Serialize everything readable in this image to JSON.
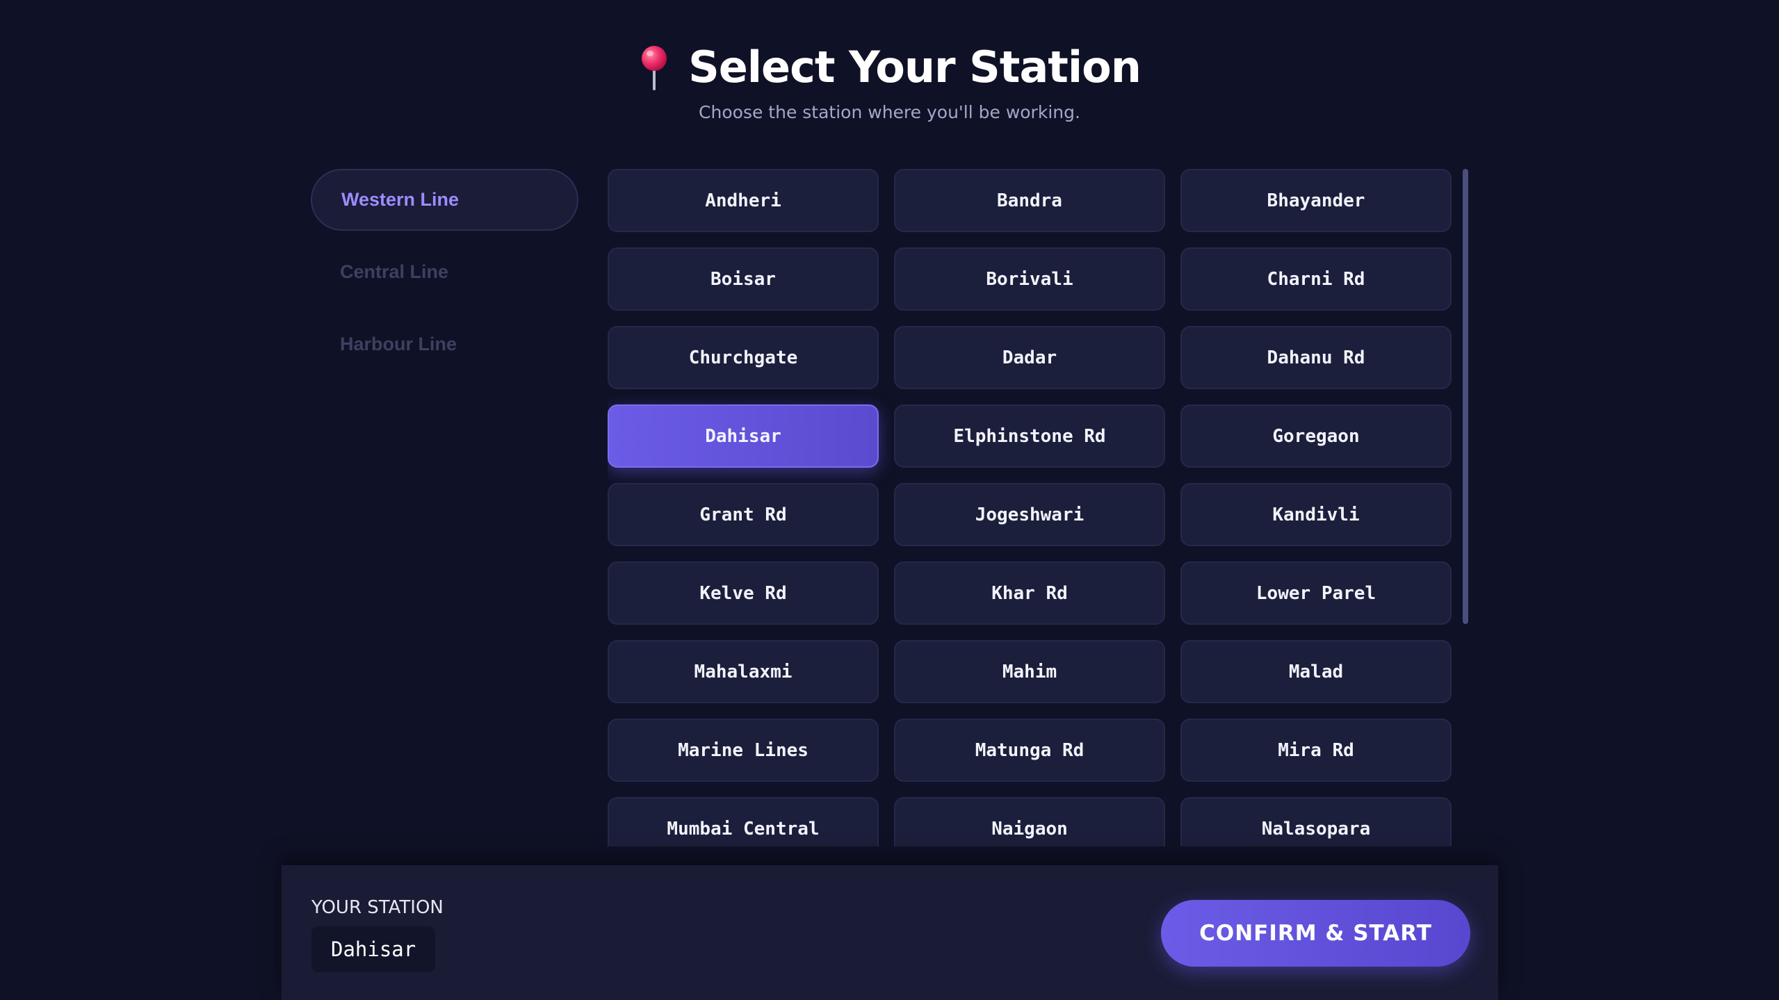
{
  "header": {
    "icon": "pushpin-icon",
    "title": "Select Your Station",
    "subtitle": "Choose the station where you'll be working."
  },
  "lines": [
    {
      "label": "Western Line",
      "active": true
    },
    {
      "label": "Central Line",
      "active": false
    },
    {
      "label": "Harbour Line",
      "active": false
    }
  ],
  "stations": [
    "Andheri",
    "Bandra",
    "Bhayander",
    "Boisar",
    "Borivali",
    "Charni Rd",
    "Churchgate",
    "Dadar",
    "Dahanu Rd",
    "Dahisar",
    "Elphinstone Rd",
    "Goregaon",
    "Grant Rd",
    "Jogeshwari",
    "Kandivli",
    "Kelve Rd",
    "Khar Rd",
    "Lower Parel",
    "Mahalaxmi",
    "Mahim",
    "Malad",
    "Marine Lines",
    "Matunga Rd",
    "Mira Rd",
    "Mumbai Central",
    "Naigaon",
    "Nalasopara"
  ],
  "selected_station": "Dahisar",
  "footer": {
    "label": "YOUR STATION",
    "value": "Dahisar",
    "confirm_label": "CONFIRM & START"
  },
  "colors": {
    "background": "#0f1126",
    "accent": "#6b5ce7",
    "card": "#1c1f3b",
    "active_tab_text": "#9d8cff"
  }
}
